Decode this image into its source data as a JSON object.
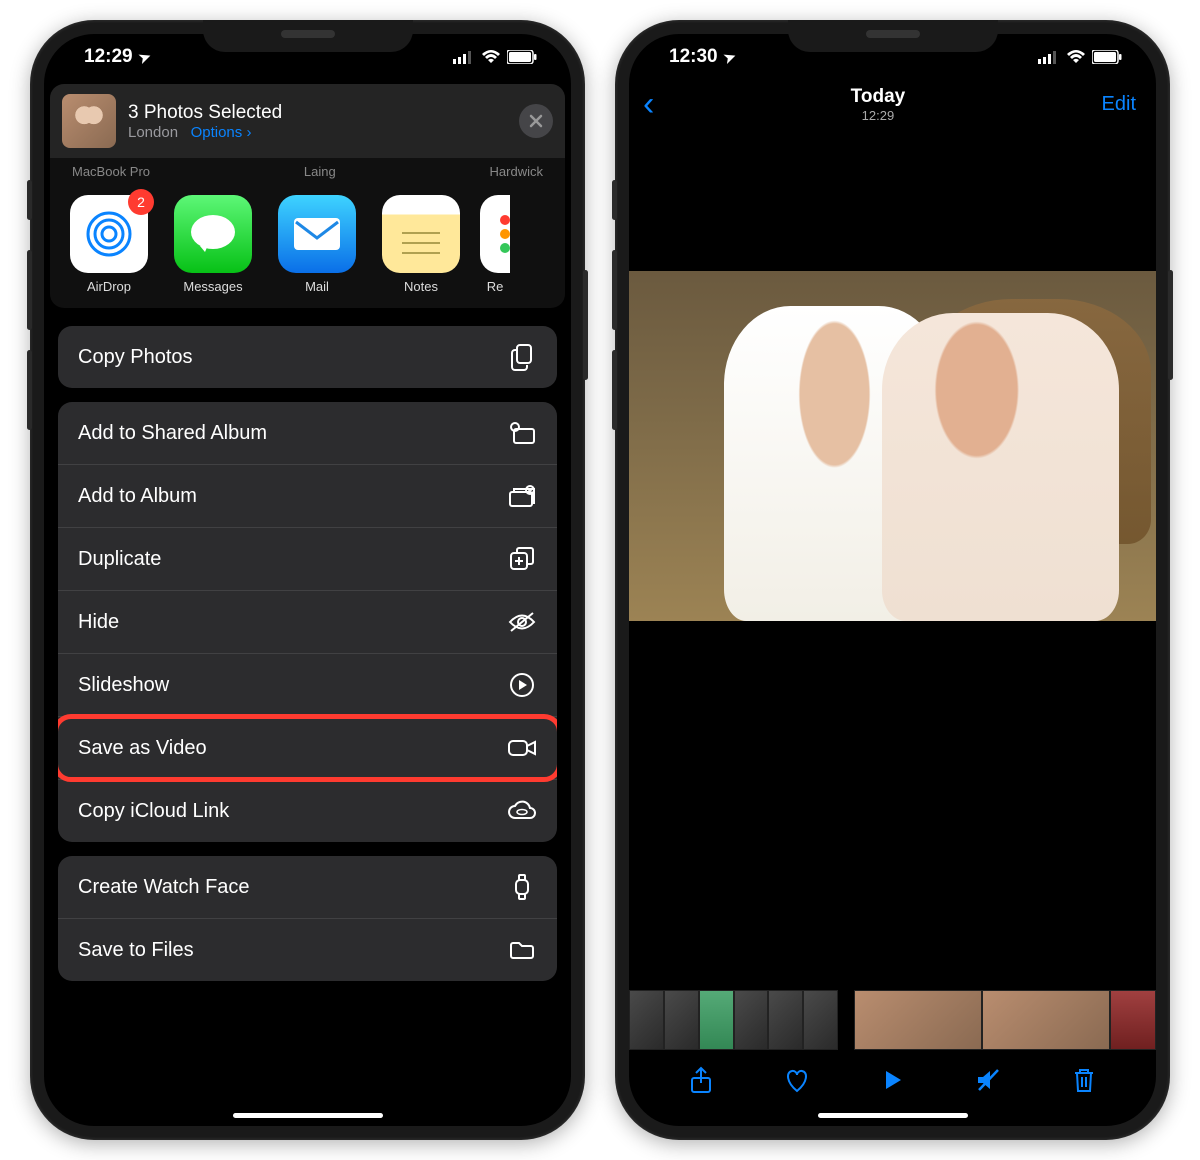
{
  "left": {
    "status": {
      "time": "12:29",
      "gps": "➤"
    },
    "header": {
      "title": "3 Photos Selected",
      "location": "London",
      "options": "Options",
      "close_aria": "Close"
    },
    "airdrop_targets": [
      "MacBook Pro",
      "Laing",
      "Hardwick"
    ],
    "apps": [
      {
        "label": "AirDrop",
        "icon": "airdrop",
        "badge": "2"
      },
      {
        "label": "Messages",
        "icon": "messages"
      },
      {
        "label": "Mail",
        "icon": "mail"
      },
      {
        "label": "Notes",
        "icon": "notes"
      },
      {
        "label": "Re",
        "icon": "re"
      }
    ],
    "actions_top": [
      {
        "label": "Copy Photos",
        "icon": "copy"
      }
    ],
    "actions_main": [
      {
        "label": "Add to Shared Album",
        "icon": "shared-album"
      },
      {
        "label": "Add to Album",
        "icon": "album-add"
      },
      {
        "label": "Duplicate",
        "icon": "duplicate"
      },
      {
        "label": "Hide",
        "icon": "hide"
      },
      {
        "label": "Slideshow",
        "icon": "play-circle"
      },
      {
        "label": "Save as Video",
        "icon": "video",
        "highlighted": true
      },
      {
        "label": "Copy iCloud Link",
        "icon": "cloud-link"
      }
    ],
    "actions_bottom": [
      {
        "label": "Create Watch Face",
        "icon": "watch"
      },
      {
        "label": "Save to Files",
        "icon": "folder"
      }
    ]
  },
  "right": {
    "status": {
      "time": "12:30",
      "gps": "➤"
    },
    "nav": {
      "back": "‹",
      "title": "Today",
      "time": "12:29",
      "edit": "Edit"
    },
    "toolbar": {
      "share": "share",
      "favorite": "heart",
      "play": "play",
      "mute": "speaker-off",
      "trash": "trash"
    }
  }
}
